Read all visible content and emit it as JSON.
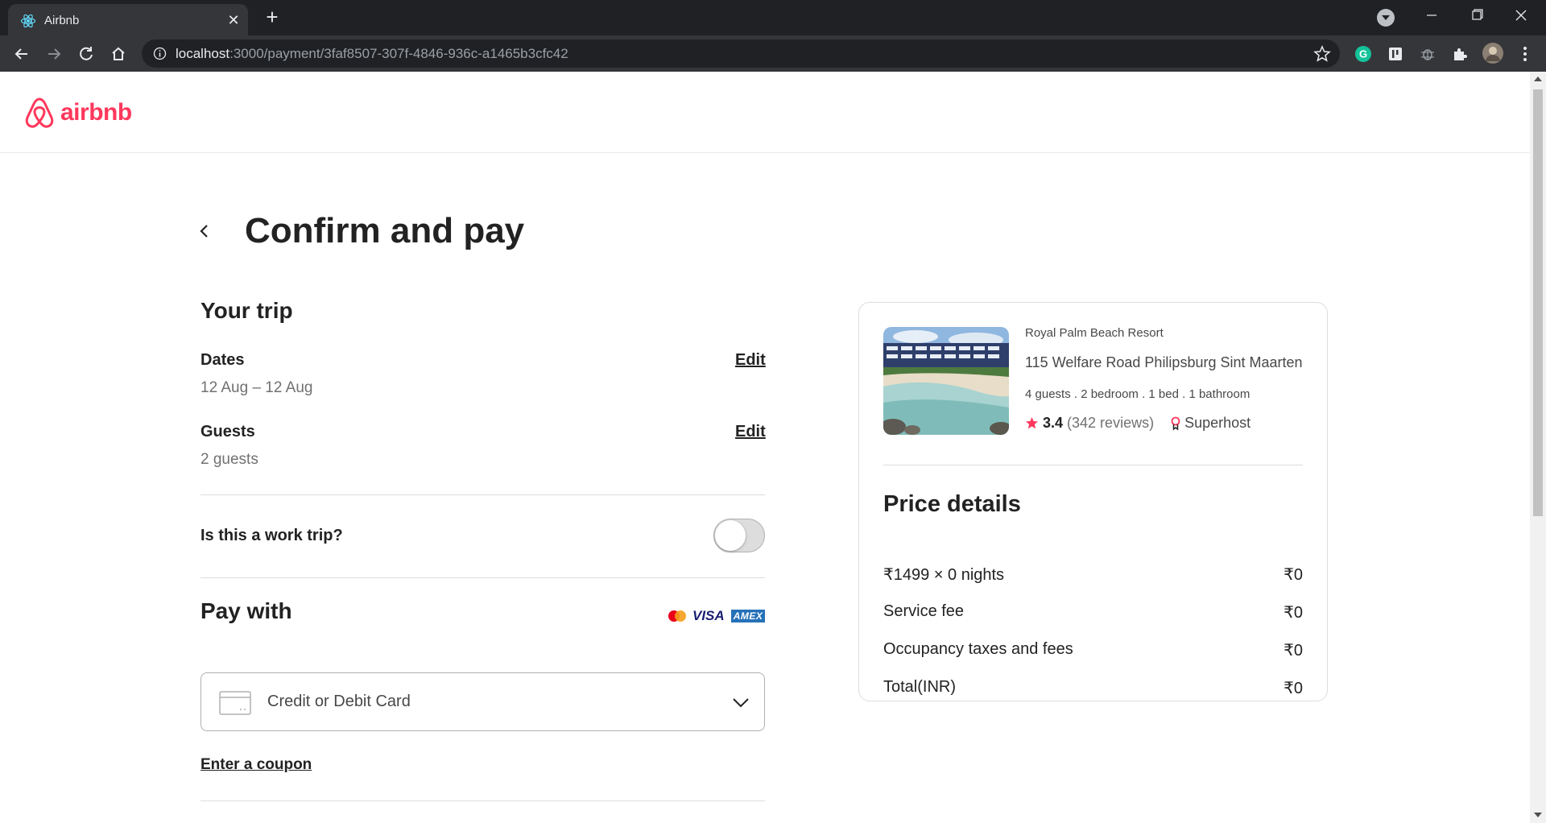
{
  "browser": {
    "tab_title": "Airbnb",
    "url_host": "localhost",
    "url_rest": ":3000/payment/3faf8507-307f-4846-936c-a1465b3cfc42"
  },
  "site": {
    "logo_text": "airbnb",
    "brand_color": "#ff385c"
  },
  "page": {
    "title": "Confirm and pay"
  },
  "trip": {
    "heading": "Your trip",
    "dates_label": "Dates",
    "dates_value": "12 Aug – 12 Aug",
    "guests_label": "Guests",
    "guests_value": "2 guests",
    "edit_label": "Edit",
    "work_trip_label": "Is this a work trip?",
    "work_trip_enabled": false
  },
  "payment": {
    "heading": "Pay with",
    "card_brands": [
      "mastercard-icon",
      "VISA",
      "AMEX"
    ],
    "method": "Credit or Debit Card",
    "coupon_label": "Enter a coupon"
  },
  "listing": {
    "name": "Royal Palm Beach Resort",
    "address": "115 Welfare Road Philipsburg Sint Maarten",
    "details": "4 guests . 2 bedroom . 1 bed . 1 bathroom",
    "rating": "3.4",
    "reviews": "(342 reviews)",
    "superhost_label": "Superhost"
  },
  "price": {
    "heading": "Price details",
    "rows": [
      {
        "label": "₹1499 × 0 nights",
        "amount": "₹0"
      },
      {
        "label": "Service fee",
        "amount": "₹0"
      },
      {
        "label": "Occupancy taxes and fees",
        "amount": "₹0"
      },
      {
        "label": "Total(INR)",
        "amount": "₹0"
      }
    ]
  }
}
